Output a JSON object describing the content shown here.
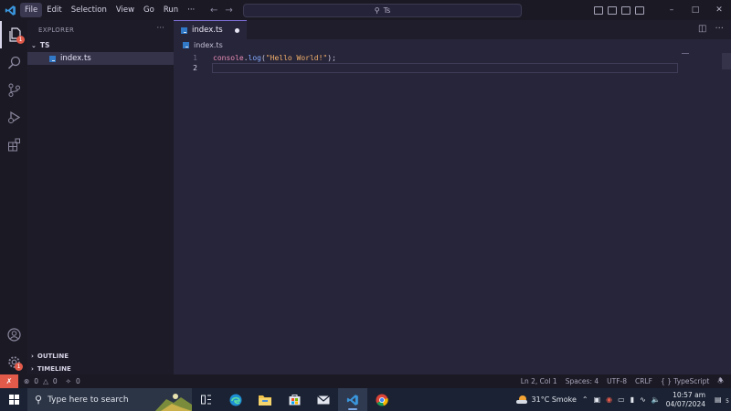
{
  "window": {
    "menu": [
      "File",
      "Edit",
      "Selection",
      "View",
      "Go",
      "Run",
      "···"
    ],
    "active_menu_index": 0,
    "search_text": "Ts",
    "controls": [
      "–",
      "□",
      "✕"
    ]
  },
  "activity_bar": {
    "explorer_badge": "1",
    "settings_badge": "1"
  },
  "sidebar": {
    "title": "EXPLORER",
    "more": "···",
    "folder": "TS",
    "files": [
      {
        "name": "index.ts",
        "selected": true
      }
    ],
    "outline": "OUTLINE",
    "timeline": "TIMELINE"
  },
  "editor": {
    "tab_label": "index.ts",
    "tab_modified": true,
    "breadcrumb": "index.ts",
    "lines": [
      {
        "number": "1",
        "tokens": [
          "console",
          ".",
          "log",
          "(",
          "\"Hello World!\"",
          ");"
        ]
      },
      {
        "number": "2",
        "tokens": []
      }
    ]
  },
  "statusbar": {
    "errors": "0",
    "warnings": "0",
    "ports": "0",
    "position": "Ln 2, Col 1",
    "spaces": "Spaces: 4",
    "encoding": "UTF-8",
    "eol": "CRLF",
    "language": "TypeScript"
  },
  "taskbar": {
    "search_placeholder": "Type here to search",
    "weather": "31°C  Smoke",
    "time": "10:57 am",
    "date": "04/07/2024",
    "notifications": "5"
  },
  "colors": {
    "editor_bg": "#27253a",
    "sidebar_bg": "#1c1b27",
    "accent": "#7c6fd6",
    "badge": "#e25a4a",
    "ts_blue": "#3178c6"
  }
}
